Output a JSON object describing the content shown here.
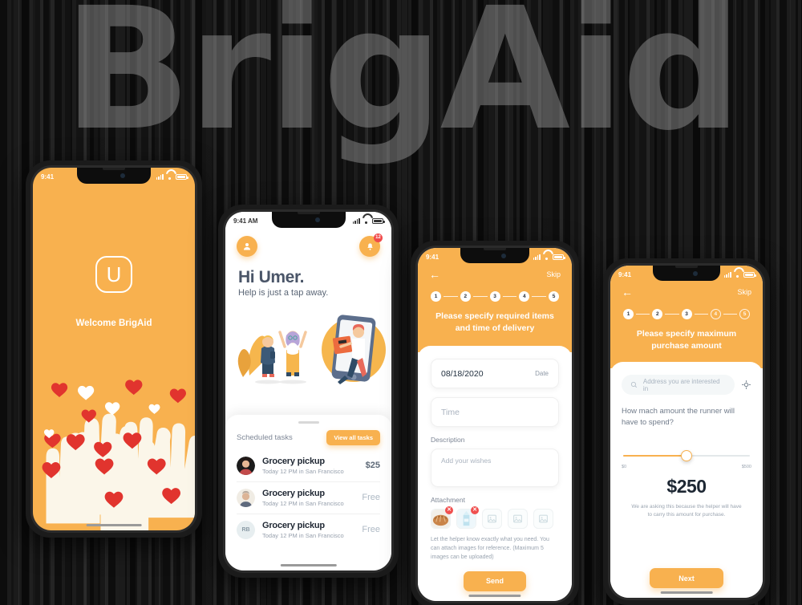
{
  "background": {
    "title": "BrigAid",
    "color": "#141414",
    "accent": "#F8B14F"
  },
  "phones": {
    "splash": {
      "statusbar": {
        "time": "9:41"
      },
      "logo_letter": "U",
      "welcome_text": "Welcome BrigAid",
      "background_color": "#F8B14F"
    },
    "home": {
      "statusbar": {
        "time": "9:41 AM"
      },
      "avatar_icon": "person-icon",
      "notification_icon": "bell-icon",
      "notification_count": "12",
      "greeting_title": "Hi Umer.",
      "greeting_subtitle": "Help is just a tap away.",
      "tasks_label": "Scheduled tasks",
      "view_all_label": "View all tasks",
      "tasks": [
        {
          "title": "Grocery pickup",
          "subtitle": "Today 12 PM in San Francisco",
          "price": "$25",
          "avatar_type": "photo-woman",
          "initials": ""
        },
        {
          "title": "Grocery pickup",
          "subtitle": "Today 12 PM in San Francisco",
          "price": "Free",
          "avatar_type": "photo-man",
          "initials": ""
        },
        {
          "title": "Grocery pickup",
          "subtitle": "Today 12 PM in San Francisco",
          "price": "Free",
          "avatar_type": "initials",
          "initials": "RB"
        }
      ]
    },
    "details": {
      "statusbar": {
        "time": "9:41"
      },
      "back_icon": "arrow-left-icon",
      "skip_label": "Skip",
      "steps": [
        {
          "number": "1",
          "state": "done"
        },
        {
          "number": "2",
          "state": "done"
        },
        {
          "number": "3",
          "state": "done"
        },
        {
          "number": "4",
          "state": "done"
        },
        {
          "number": "5",
          "state": "done"
        }
      ],
      "title": "Please specify required items and time of delivery",
      "date_value": "08/18/2020",
      "date_suffix": "Date",
      "time_placeholder": "Time",
      "description_label": "Description",
      "description_placeholder": "Add your wishes",
      "attachment_label": "Attachment",
      "attachments": [
        {
          "type": "image",
          "name": "bread"
        },
        {
          "type": "image",
          "name": "milk"
        },
        {
          "type": "empty",
          "name": ""
        },
        {
          "type": "empty",
          "name": ""
        },
        {
          "type": "empty",
          "name": ""
        }
      ],
      "hint": "Let the helper know exactly what you need. You can attach images for reference. (Maximum 5 images can be uploaded)",
      "send_label": "Send"
    },
    "amount": {
      "statusbar": {
        "time": "9:41"
      },
      "back_icon": "arrow-left-icon",
      "skip_label": "Skip",
      "steps": [
        {
          "number": "1",
          "state": "done"
        },
        {
          "number": "2",
          "state": "done"
        },
        {
          "number": "3",
          "state": "done"
        },
        {
          "number": "4",
          "state": "todo"
        },
        {
          "number": "5",
          "state": "todo"
        }
      ],
      "title": "Please specify maximum purchase amount",
      "search_placeholder": "Address you are interested in",
      "search_icon": "search-icon",
      "locate_icon": "crosshair-icon",
      "question": "How mach amount the runner will have to spend?",
      "slider": {
        "min_label": "$0",
        "max_label": "$500",
        "value_percent": 50
      },
      "amount_value": "$250",
      "amount_note": "We are asking this because the helper will have to carry this amount for purchase.",
      "next_label": "Next"
    }
  }
}
